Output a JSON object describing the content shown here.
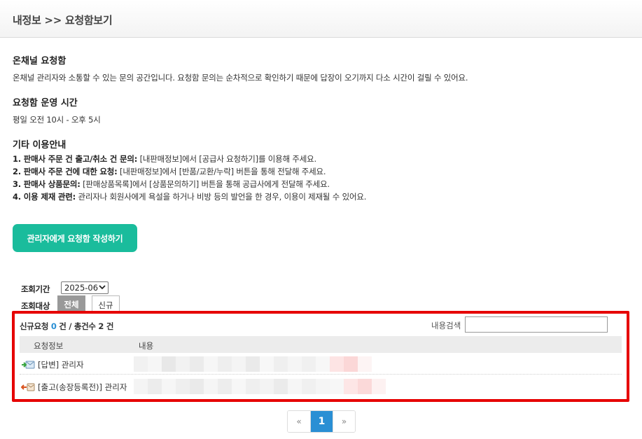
{
  "header": {
    "title": "내정보 >> 요청함보기"
  },
  "intro": {
    "title": "온채널 요청함",
    "description": "온채널 관리자와 소통할 수 있는 문의 공간입니다. 요청함 문의는 순차적으로 확인하기 때문에 답장이 오기까지 다소 시간이 걸릴 수 있어요."
  },
  "hours": {
    "title": "요청함 운영 시간",
    "text": "평일 오전 10시 - 오후 5시"
  },
  "guide": {
    "title": "기타 이용안내",
    "items": [
      {
        "label": "1. 판매사 주문 건 출고/취소 건 문의:",
        "text": " [내판매정보]에서 [공급사 요청하기]를 이용해 주세요."
      },
      {
        "label": "2. 판매사 주문 건에 대한 요청:",
        "text": " [내판매정보]에서 [반품/교환/누락] 버튼을 통해 전달해 주세요."
      },
      {
        "label": "3. 판매사 상품문의:",
        "text": " [판매상품목록]에서 [상품문의하기] 버튼을 통해 공급사에게 전달해 주세요."
      },
      {
        "label": "4. 이용 제재 관련:",
        "text": " 관리자나 회원사에게 욕설을 하거나 비방 등의 발언을 한 경우, 이용이 제재될 수 있어요."
      }
    ]
  },
  "write_button": "관리자에게 요청함 작성하기",
  "filter": {
    "period_label": "조회기간",
    "period_value": "2025-06",
    "target_label": "조회대상",
    "tabs": [
      "전체",
      "신규"
    ]
  },
  "summary": {
    "new_label": "신규요청",
    "new_count": "0",
    "sep": "건 / 총건수",
    "total_count": "2",
    "unit": "건"
  },
  "search": {
    "label": "내용검색",
    "value": ""
  },
  "table": {
    "headers": [
      "요청정보",
      "내용"
    ],
    "rows": [
      {
        "icon": "reply-arrow-icon",
        "tag": "[답변]",
        "author": "관리자"
      },
      {
        "icon": "shipping-return-icon",
        "tag": "[출고(송장등록전)]",
        "author": "관리자"
      }
    ]
  },
  "pagination": {
    "prev": "«",
    "current": "1",
    "next": "»"
  },
  "colors": {
    "accent": "#1abc9c",
    "highlight_border": "#e60000",
    "active_page": "#2a8fd4"
  }
}
